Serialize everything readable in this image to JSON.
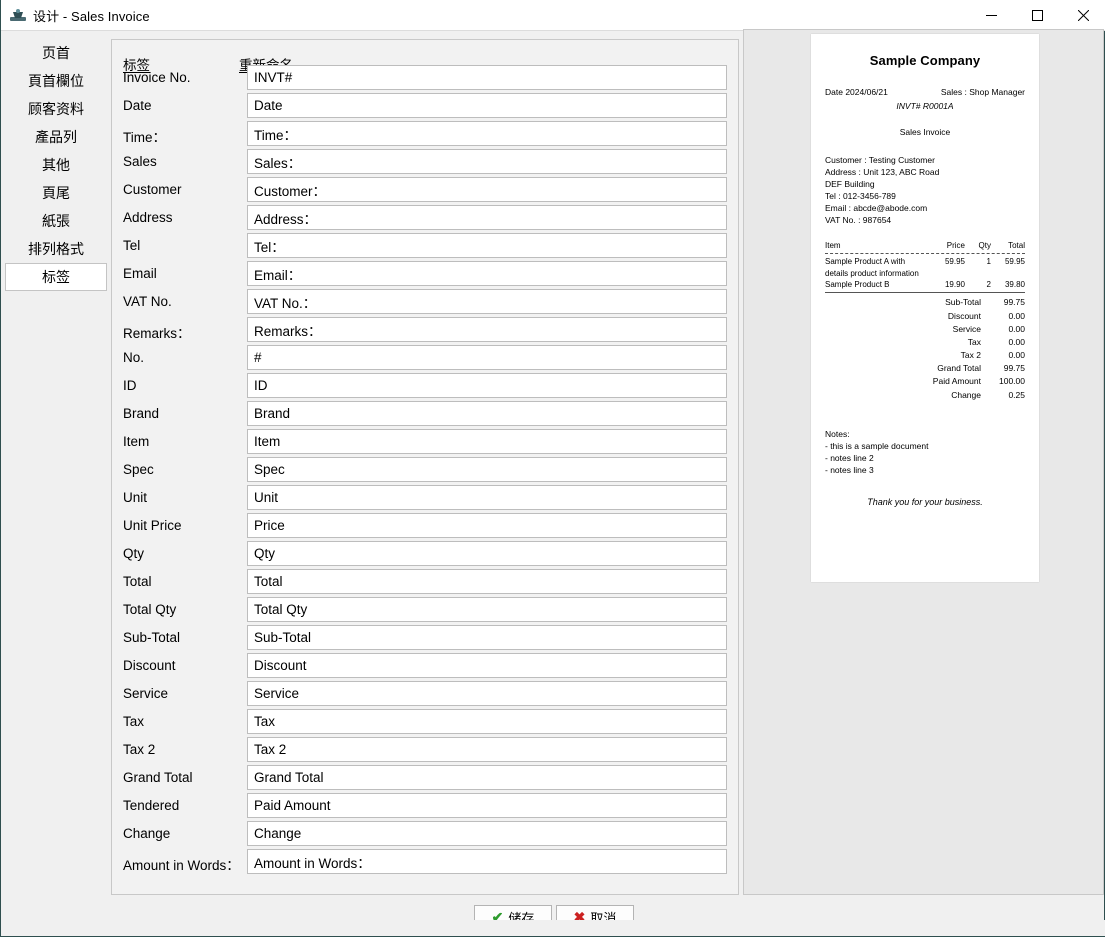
{
  "window": {
    "title": "设计 - Sales Invoice",
    "icon": "app-icon",
    "minimize_label": "—",
    "maximize_label": "▢",
    "close_label": "✕"
  },
  "sidebar": {
    "items": [
      {
        "label": "页首",
        "selected": false
      },
      {
        "label": "頁首欄位",
        "selected": false
      },
      {
        "label": "顾客资料",
        "selected": false
      },
      {
        "label": "產品列",
        "selected": false
      },
      {
        "label": "其他",
        "selected": false
      },
      {
        "label": "頁尾",
        "selected": false
      },
      {
        "label": "紙張",
        "selected": false
      },
      {
        "label": "排列格式",
        "selected": false
      },
      {
        "label": "标签",
        "selected": true
      }
    ]
  },
  "form": {
    "column_headers": {
      "label": "标签",
      "rename": "重新命名"
    },
    "rows": [
      {
        "label": "Invoice No.",
        "value": "INVT#"
      },
      {
        "label": "Date",
        "value": "Date"
      },
      {
        "label": "Time：",
        "value": "Time："
      },
      {
        "label": "Sales",
        "value": "Sales："
      },
      {
        "label": "Customer",
        "value": "Customer："
      },
      {
        "label": "Address",
        "value": "Address："
      },
      {
        "label": "Tel",
        "value": "Tel："
      },
      {
        "label": "Email",
        "value": "Email："
      },
      {
        "label": "VAT No.",
        "value": "VAT No.："
      },
      {
        "label": "Remarks：",
        "value": "Remarks："
      },
      {
        "label": "No.",
        "value": "#"
      },
      {
        "label": "ID",
        "value": "ID"
      },
      {
        "label": "Brand",
        "value": "Brand"
      },
      {
        "label": "Item",
        "value": "Item"
      },
      {
        "label": "Spec",
        "value": "Spec"
      },
      {
        "label": "Unit",
        "value": "Unit"
      },
      {
        "label": "Unit Price",
        "value": "Price"
      },
      {
        "label": "Qty",
        "value": "Qty"
      },
      {
        "label": "Total",
        "value": "Total"
      },
      {
        "label": "Total Qty",
        "value": "Total Qty"
      },
      {
        "label": "Sub-Total",
        "value": "Sub-Total"
      },
      {
        "label": "Discount",
        "value": "Discount"
      },
      {
        "label": "Service",
        "value": "Service"
      },
      {
        "label": "Tax",
        "value": "Tax"
      },
      {
        "label": "Tax 2",
        "value": "Tax 2"
      },
      {
        "label": "Grand Total",
        "value": "Grand Total"
      },
      {
        "label": "Tendered",
        "value": "Paid Amount"
      },
      {
        "label": "Change",
        "value": "Change"
      },
      {
        "label": "Amount in Words：",
        "value": "Amount in Words："
      }
    ]
  },
  "preview": {
    "company": "Sample Company",
    "date_line": "Date 2024/06/21",
    "sales_line": "Sales : Shop Manager",
    "invoice_no": "INVT# R0001A",
    "doc_type": "Sales Invoice",
    "customer_lines": [
      "Customer : Testing Customer",
      "Address : Unit 123, ABC Road",
      "DEF Building",
      "Tel : 012-3456-789",
      "Email : abcde@abode.com",
      "VAT No. : 987654"
    ],
    "table": {
      "headers": {
        "item": "Item",
        "price": "Price",
        "qty": "Qty",
        "total": "Total"
      },
      "rows": [
        {
          "item": "Sample Product A with",
          "wrap": "details product information",
          "price": "59.95",
          "qty": "1",
          "total": "59.95"
        },
        {
          "item": "Sample Product B",
          "wrap": "",
          "price": "19.90",
          "qty": "2",
          "total": "39.80"
        }
      ]
    },
    "totals": [
      {
        "label": "Sub-Total",
        "value": "99.75"
      },
      {
        "label": "Discount",
        "value": "0.00"
      },
      {
        "label": "Service",
        "value": "0.00"
      },
      {
        "label": "Tax",
        "value": "0.00"
      },
      {
        "label": "Tax 2",
        "value": "0.00"
      },
      {
        "label": "Grand Total",
        "value": "99.75"
      },
      {
        "label": "Paid Amount",
        "value": "100.00"
      },
      {
        "label": "Change",
        "value": "0.25"
      }
    ],
    "notes_title": "Notes:",
    "notes": [
      "- this is a sample document",
      "- notes line 2",
      "- notes line 3"
    ],
    "thanks": "Thank you for your business."
  },
  "buttons": {
    "save": "储存",
    "cancel": "取消",
    "save_icon": "check-icon",
    "cancel_icon": "cross-icon"
  }
}
